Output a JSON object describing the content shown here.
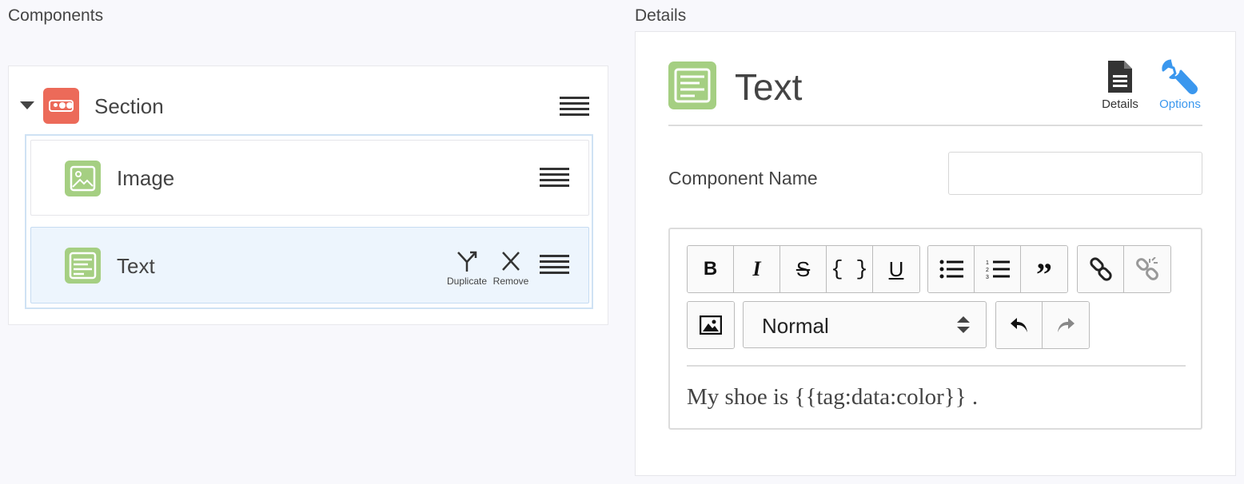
{
  "components_panel": {
    "heading": "Components",
    "section": {
      "label": "Section"
    },
    "children": [
      {
        "label": "Image"
      },
      {
        "label": "Text",
        "actions": {
          "duplicate": "Duplicate",
          "remove": "Remove"
        }
      }
    ]
  },
  "details_panel": {
    "heading": "Details",
    "title": "Text",
    "tabs": {
      "details": "Details",
      "options": "Options"
    },
    "component_name_label": "Component Name",
    "component_name_value": "",
    "toolbar": {
      "bold": "B",
      "italic": "I",
      "strike": "S",
      "code": "{ }",
      "underline": "U",
      "quote": "”",
      "format_select": "Normal"
    },
    "editor_content": "My shoe is {{tag:data:color}} ."
  },
  "colors": {
    "section_icon": "#ec6a59",
    "component_icon": "#a5cf82",
    "accent": "#3a97ee",
    "selected_row": "#edf5fd"
  }
}
